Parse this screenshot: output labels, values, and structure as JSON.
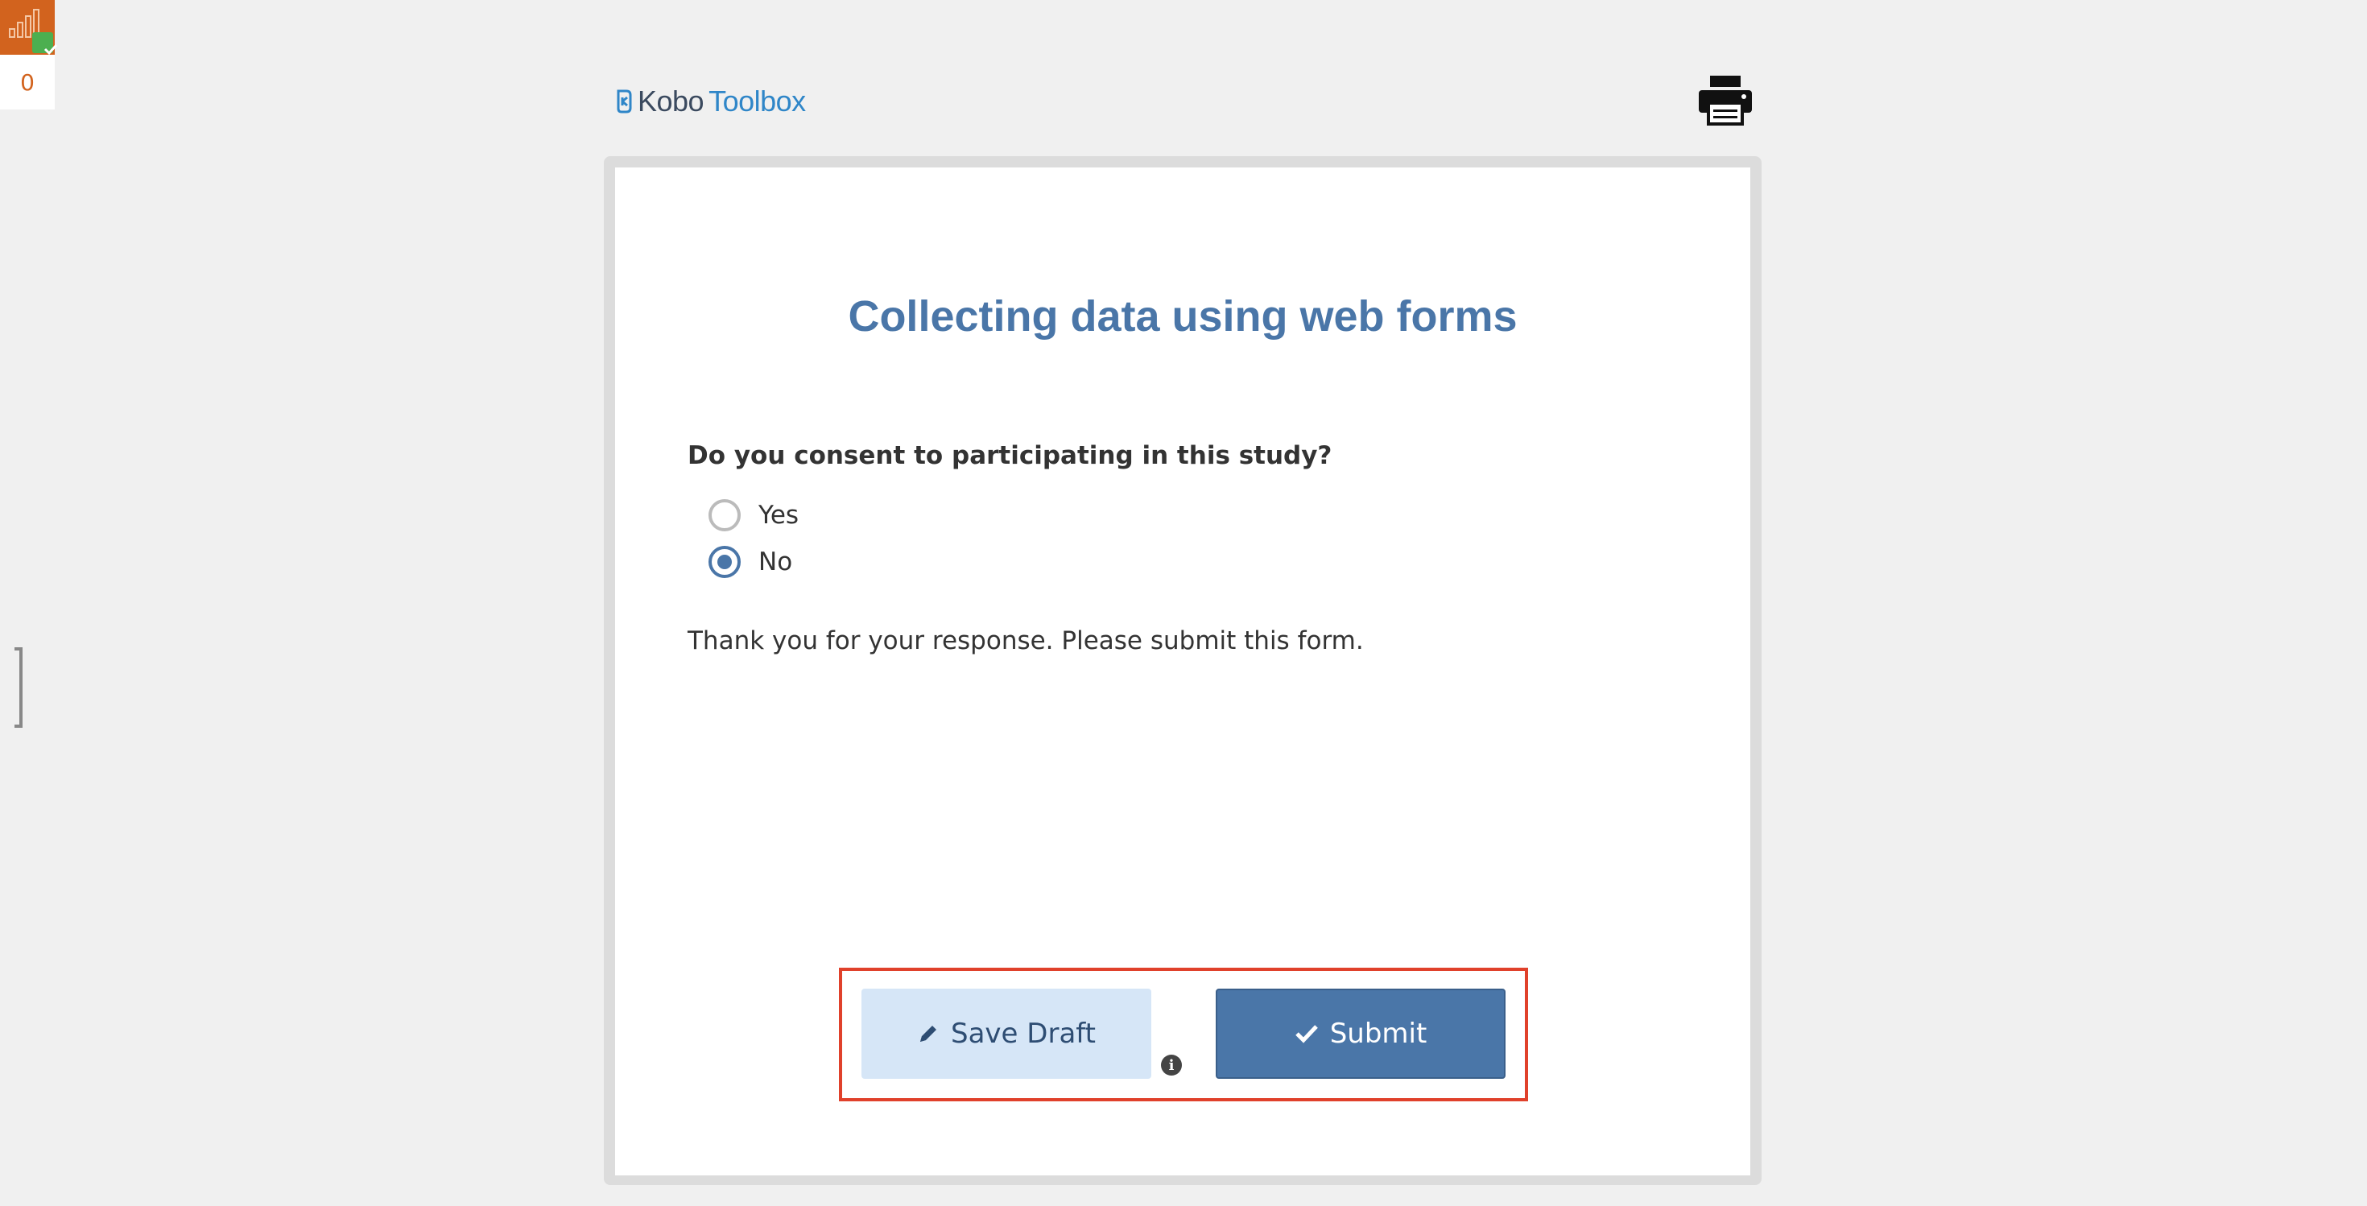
{
  "status_widget": {
    "queued_count": "0"
  },
  "header": {
    "logo": {
      "part1": "Kobo",
      "part2": "Toolbox"
    }
  },
  "form": {
    "title": "Collecting data using web forms",
    "question": {
      "label": "Do you consent to participating in this study?",
      "options": [
        {
          "label": "Yes",
          "selected": false
        },
        {
          "label": "No",
          "selected": true
        }
      ]
    },
    "note": "Thank you for your response. Please submit this form."
  },
  "actions": {
    "save_draft_label": "Save Draft",
    "submit_label": "Submit"
  },
  "colors": {
    "accent": "#4a76a8",
    "highlight": "#e0412b",
    "widget": "#d2631e"
  }
}
